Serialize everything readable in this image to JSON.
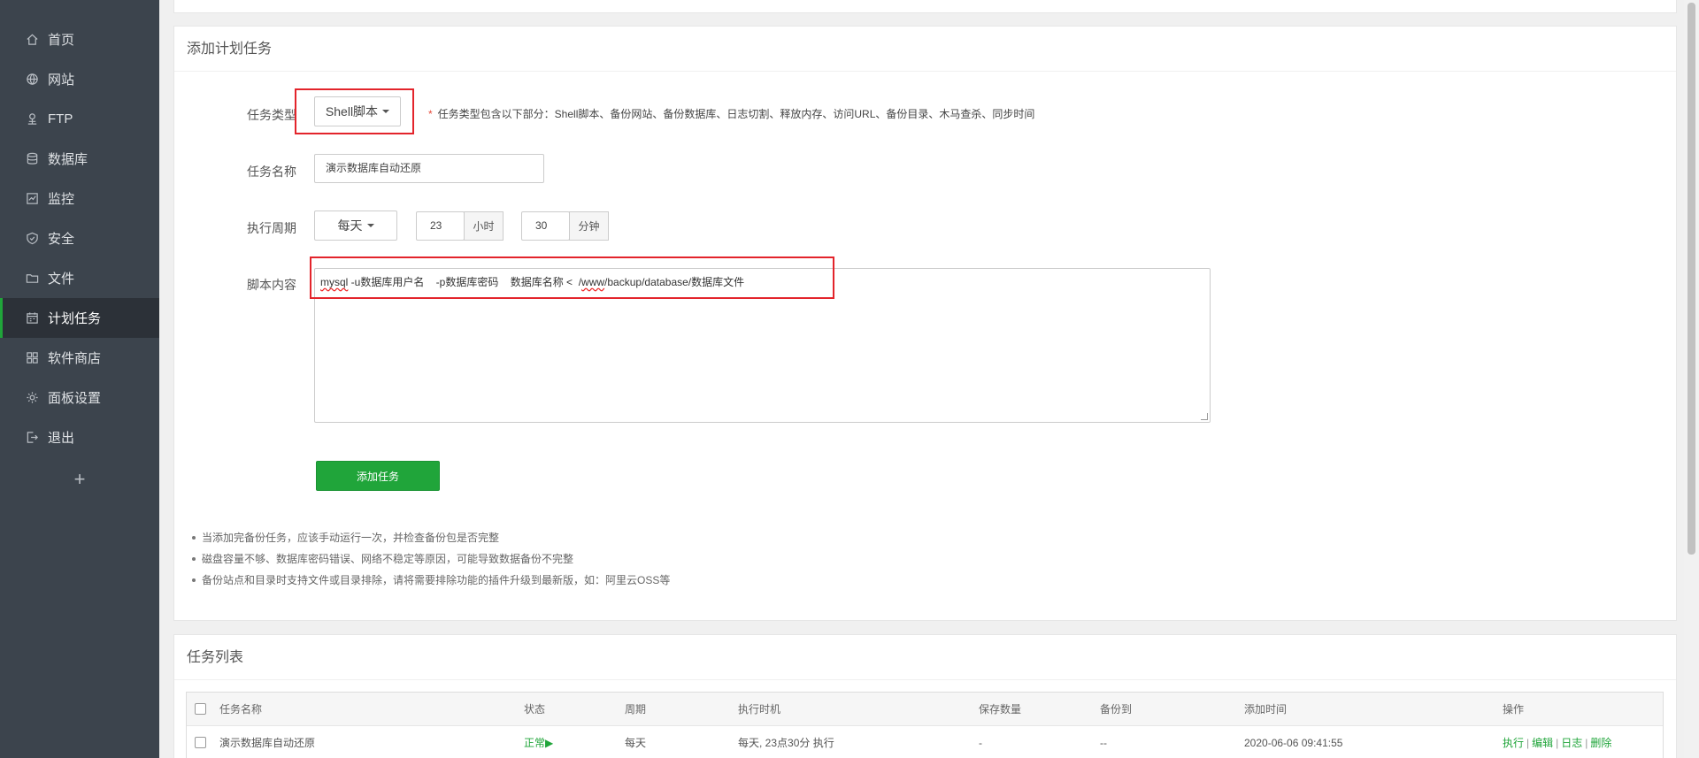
{
  "sidebar": {
    "items": [
      {
        "label": "首页",
        "icon": "home-icon"
      },
      {
        "label": "网站",
        "icon": "globe-icon"
      },
      {
        "label": "FTP",
        "icon": "ftp-icon"
      },
      {
        "label": "数据库",
        "icon": "database-icon"
      },
      {
        "label": "监控",
        "icon": "monitor-icon"
      },
      {
        "label": "安全",
        "icon": "shield-icon"
      },
      {
        "label": "文件",
        "icon": "folder-icon"
      },
      {
        "label": "计划任务",
        "icon": "calendar-icon",
        "active": true
      },
      {
        "label": "软件商店",
        "icon": "grid-icon"
      },
      {
        "label": "面板设置",
        "icon": "gear-icon"
      },
      {
        "label": "退出",
        "icon": "logout-icon"
      }
    ],
    "add_label": "+"
  },
  "add_task": {
    "title": "添加计划任务",
    "task_type": {
      "label": "任务类型",
      "value": "Shell脚本",
      "hint_star": "*",
      "hint": "任务类型包含以下部分：Shell脚本、备份网站、备份数据库、日志切割、释放内存、访问URL、备份目录、木马查杀、同步时间"
    },
    "task_name": {
      "label": "任务名称",
      "value": "演示数据库自动还原"
    },
    "cycle": {
      "label": "执行周期",
      "period": "每天",
      "hour": "23",
      "hour_unit": "小时",
      "minute": "30",
      "minute_unit": "分钟"
    },
    "script": {
      "label": "脚本内容",
      "cmd": "mysql",
      "part1": " -u数据库用户名    -p数据库密码    数据库名称 <  /",
      "www": "www",
      "part2": "/backup/database/数据库文件"
    },
    "submit_label": "添加任务",
    "notes": [
      "当添加完备份任务，应该手动运行一次，并检查备份包是否完整",
      "磁盘容量不够、数据库密码错误、网络不稳定等原因，可能导致数据备份不完整",
      "备份站点和目录时支持文件或目录排除，请将需要排除功能的插件升级到最新版，如：阿里云OSS等"
    ]
  },
  "task_list": {
    "title": "任务列表",
    "columns": [
      "任务名称",
      "状态",
      "周期",
      "执行时机",
      "保存数量",
      "备份到",
      "添加时间",
      "操作"
    ],
    "rows": [
      {
        "name": "演示数据库自动还原",
        "status": "正常",
        "status_icon": "play-icon",
        "status_color": "#20a53a",
        "period": "每天",
        "timing": "每天, 23点30分 执行",
        "keep": "-",
        "backup_to": "--",
        "added": "2020-06-06 09:41:55",
        "actions": [
          "执行",
          "编辑",
          "日志",
          "删除"
        ]
      }
    ]
  },
  "colors": {
    "sidebar_bg": "#3c444d",
    "accent": "#20a53a",
    "highlight_box": "#e3242b"
  }
}
